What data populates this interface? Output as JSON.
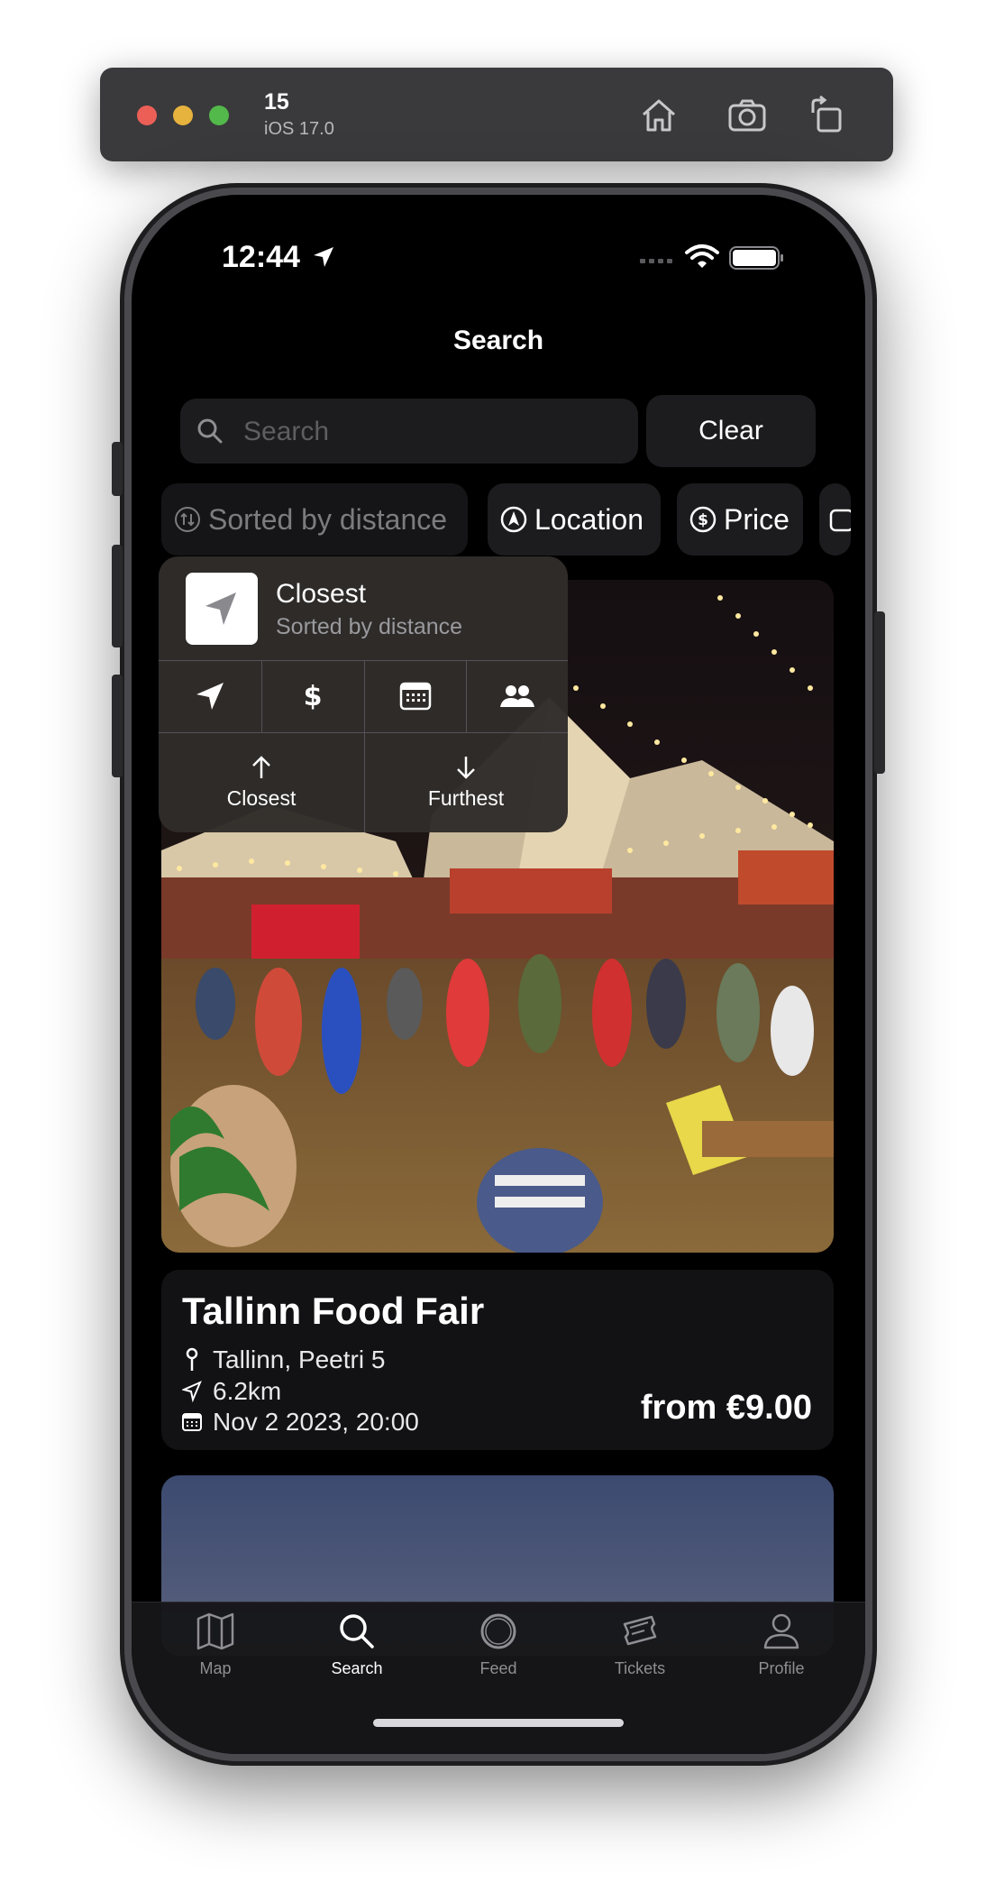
{
  "simulator": {
    "device_name": "15",
    "os_version": "iOS 17.0"
  },
  "status_bar": {
    "time": "12:44"
  },
  "nav": {
    "title": "Search"
  },
  "search": {
    "placeholder": "Search",
    "value": "",
    "clear_label": "Clear"
  },
  "filters": [
    {
      "label": "Sorted by distance",
      "icon": "sort-arrows-icon",
      "active": false
    },
    {
      "label": "Location",
      "icon": "location-arrow-icon"
    },
    {
      "label": "Price",
      "icon": "dollar-circle-icon"
    }
  ],
  "sort_menu": {
    "title": "Closest",
    "subtitle": "Sorted by distance",
    "options": [
      "location-arrow-icon",
      "dollar-icon",
      "calendar-icon",
      "people-icon"
    ],
    "ascending_label": "Closest",
    "descending_label": "Furthest"
  },
  "event": {
    "title": "Tallinn Food Fair",
    "address": "Tallinn, Peetri 5",
    "distance": "6.2km",
    "date": "Nov 2 2023, 20:00",
    "price": "from €9.00"
  },
  "tabs": [
    {
      "label": "Map",
      "icon": "map-icon",
      "active": false
    },
    {
      "label": "Search",
      "icon": "search-icon",
      "active": true
    },
    {
      "label": "Feed",
      "icon": "circle-icon",
      "active": false
    },
    {
      "label": "Tickets",
      "icon": "ticket-icon",
      "active": false
    },
    {
      "label": "Profile",
      "icon": "person-icon",
      "active": false
    }
  ],
  "colors": {
    "background": "#000000",
    "card": "#1c1c1e",
    "tab_inactive": "#8e8e93",
    "tab_active": "#ffffff"
  }
}
